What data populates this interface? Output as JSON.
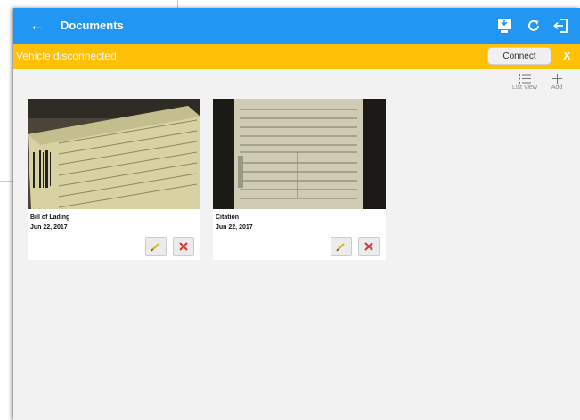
{
  "appbar": {
    "back_icon": "←",
    "title": "Documents",
    "icons": [
      "device-transfer-icon",
      "refresh-icon",
      "logout-icon"
    ],
    "color": "#2196f3"
  },
  "banner": {
    "message": "Vehicle disconnected",
    "connect_label": "Connect",
    "close_label": "X",
    "color": "#ffc107"
  },
  "toolbar": {
    "list_view_label": "List View",
    "add_label": "Add"
  },
  "documents": [
    {
      "name": "Bill of Lading",
      "date": "Jun 22, 2017"
    },
    {
      "name": "Citation",
      "date": "Jun 22, 2017"
    }
  ]
}
